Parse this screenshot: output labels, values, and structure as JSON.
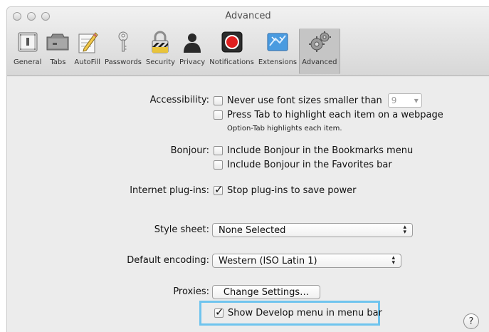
{
  "window": {
    "title": "Advanced"
  },
  "toolbar": [
    {
      "label": "General",
      "icon": "general-switch-icon"
    },
    {
      "label": "Tabs",
      "icon": "tabs-icon"
    },
    {
      "label": "AutoFill",
      "icon": "autofill-pencil-icon"
    },
    {
      "label": "Passwords",
      "icon": "key-icon"
    },
    {
      "label": "Security",
      "icon": "padlock-icon"
    },
    {
      "label": "Privacy",
      "icon": "person-silhouette-icon"
    },
    {
      "label": "Notifications",
      "icon": "notifications-record-icon"
    },
    {
      "label": "Extensions",
      "icon": "puzzle-icon"
    },
    {
      "label": "Advanced",
      "icon": "gears-icon",
      "selected": true
    }
  ],
  "accessibility": {
    "label": "Accessibility:",
    "min_font": {
      "label": "Never use font sizes smaller than",
      "checked": false,
      "value": "9"
    },
    "press_tab": {
      "label": "Press Tab to highlight each item on a webpage",
      "checked": false
    },
    "hint": "Option-Tab highlights each item."
  },
  "bonjour": {
    "label": "Bonjour:",
    "bookmarks": {
      "label": "Include Bonjour in the Bookmarks menu",
      "checked": false
    },
    "favorites": {
      "label": "Include Bonjour in the Favorites bar",
      "checked": false
    }
  },
  "plugins": {
    "label": "Internet plug-ins:",
    "stop": {
      "label": "Stop plug-ins to save power",
      "checked": true
    }
  },
  "stylesheet": {
    "label": "Style sheet:",
    "value": "None Selected"
  },
  "encoding": {
    "label": "Default encoding:",
    "value": "Western (ISO Latin 1)"
  },
  "proxies": {
    "label": "Proxies:",
    "button": "Change Settings…"
  },
  "develop": {
    "label": "Show Develop menu in menu bar",
    "checked": true
  },
  "help": {
    "label": "?"
  },
  "colors": {
    "highlight": "#6fc4ee",
    "record_red": "#e02020",
    "extensions_blue": "#4a9be0"
  }
}
